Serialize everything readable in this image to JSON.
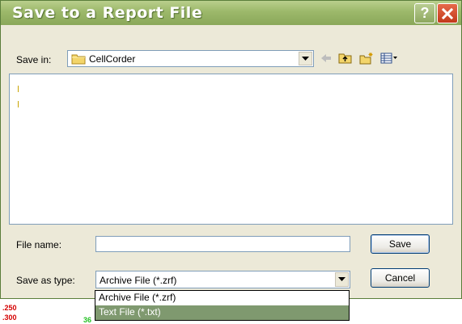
{
  "window": {
    "title": "Save to a Report File",
    "help_label": "?",
    "close_icon": "close-icon",
    "titlebar_color": "#9cb86a"
  },
  "save_in": {
    "label": "Save in:",
    "value": "CellCorder",
    "icons": [
      "folder-icon",
      "chevron-down-icon",
      "back-arrow-icon",
      "up-folder-icon",
      "new-folder-icon",
      "view-menu-icon"
    ]
  },
  "file_list": {
    "items": []
  },
  "file_name": {
    "label": "File name:",
    "value": ""
  },
  "save_as_type": {
    "label": "Save as type:",
    "value": "Archive File (*.zrf)",
    "options": [
      "Archive File (*.zrf)",
      "Text File (*.txt)"
    ],
    "highlighted_option": 1,
    "highlight_color": "#7f996f"
  },
  "buttons": {
    "save_label": "Save",
    "cancel_label": "Cancel"
  },
  "background": {
    "red_labels": [
      ".250",
      ".300"
    ],
    "green_label": "36"
  }
}
